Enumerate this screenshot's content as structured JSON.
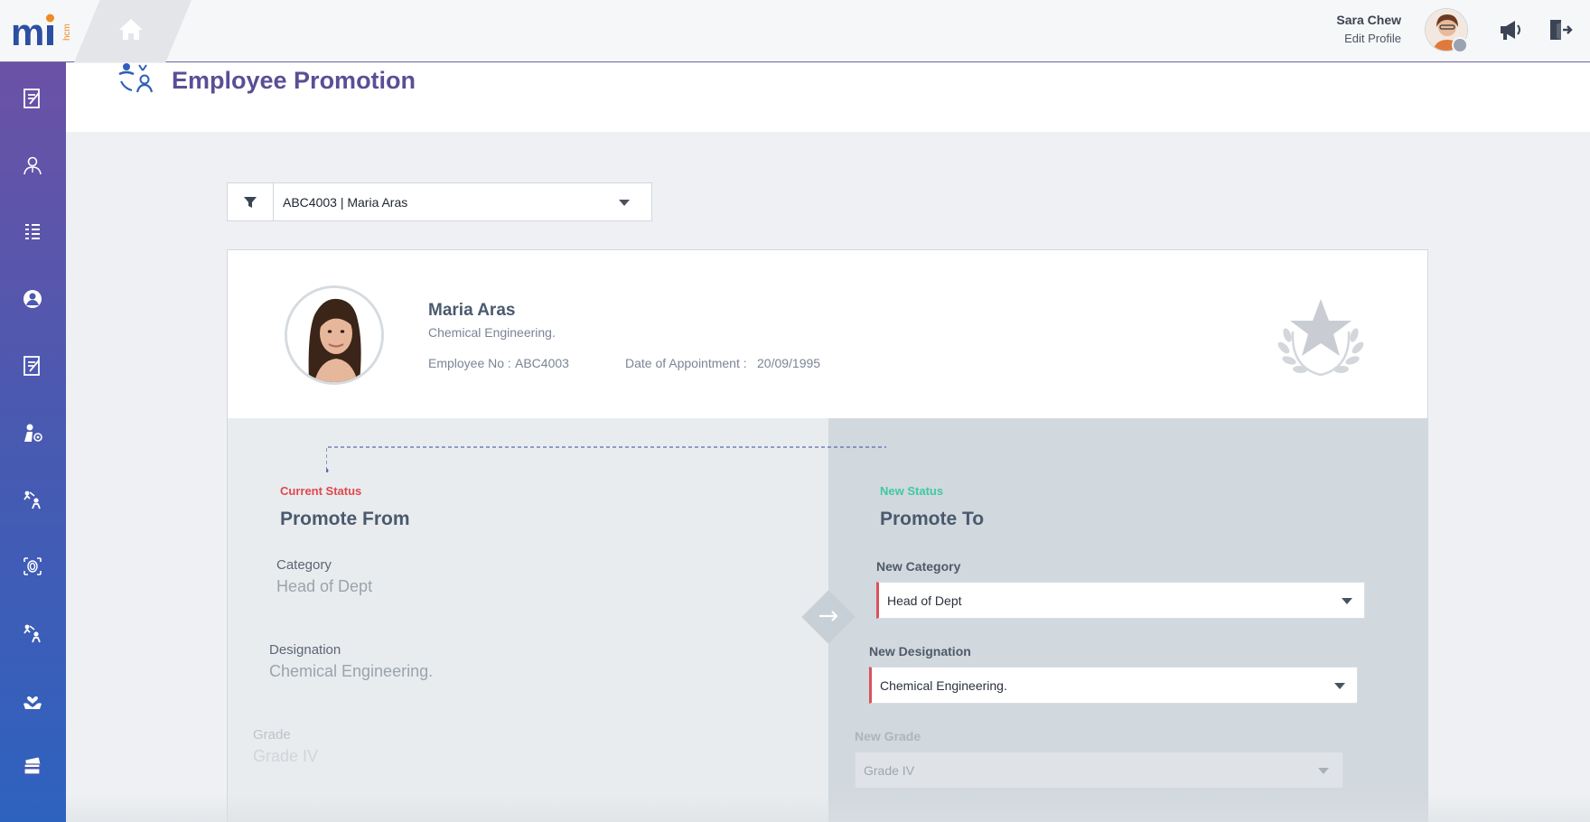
{
  "header": {
    "user_name": "Sara Chew",
    "edit_profile": "Edit Profile"
  },
  "page": {
    "title": "Employee Promotion"
  },
  "filter": {
    "selected": "ABC4003 | Maria Aras"
  },
  "employee": {
    "name": "Maria Aras",
    "department": "Chemical Engineering.",
    "employee_no_label": "Employee No :",
    "employee_no": "ABC4003",
    "appointment_label": "Date of Appointment :",
    "appointment_date": "20/09/1995"
  },
  "current": {
    "status_label": "Current Status",
    "title": "Promote From",
    "category_label": "Category",
    "category_value": "Head of Dept",
    "designation_label": "Designation",
    "designation_value": "Chemical Engineering.",
    "grade_label": "Grade",
    "grade_value": "Grade IV"
  },
  "new": {
    "status_label": "New Status",
    "title": "Promote To",
    "category_label": "New Category",
    "category_value": "Head of Dept",
    "designation_label": "New Designation",
    "designation_value": "Chemical Engineering.",
    "grade_label": "New Grade",
    "grade_value": "Grade IV"
  },
  "colors": {
    "current_status": "#e0474f",
    "new_status": "#3fc9a5",
    "title": "#5a4f96",
    "accent_border": "#d9535b"
  },
  "sidebar": {
    "icons": [
      "form-icon",
      "employee-icon",
      "list-icon",
      "profile-icon",
      "form-icon",
      "person-settings-icon",
      "promotion-icon",
      "fingerprint-icon",
      "transfer-icon",
      "care-icon",
      "payment-card-icon"
    ]
  }
}
